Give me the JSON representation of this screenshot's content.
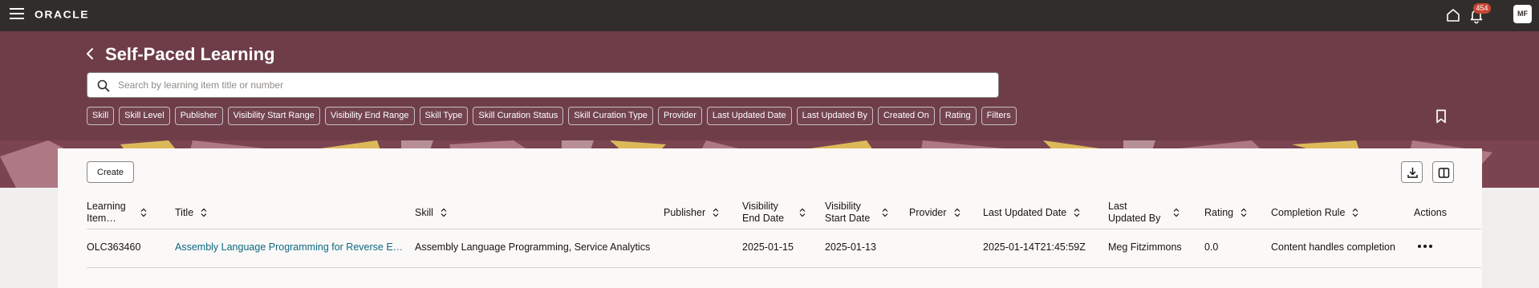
{
  "topbar": {
    "logo": "ORACLE",
    "notification_count": "454",
    "avatar_initials": "MF"
  },
  "header": {
    "title": "Self-Paced Learning",
    "search_placeholder": "Search by learning item title or number",
    "filters": [
      "Skill",
      "Skill Level",
      "Publisher",
      "Visibility Start Range",
      "Visibility End Range",
      "Skill Type",
      "Skill Curation Status",
      "Skill Curation Type",
      "Provider",
      "Last Updated Date",
      "Last Updated By",
      "Created On",
      "Rating",
      "Filters"
    ]
  },
  "toolbar": {
    "create_label": "Create"
  },
  "table": {
    "columns": [
      "Learning Item…",
      "Title",
      "Skill",
      "Publisher",
      "Visibility End Date",
      "Visibility Start Date",
      "Provider",
      "Last Updated Date",
      "Last Updated By",
      "Rating",
      "Completion Rule",
      "Actions"
    ],
    "rows": [
      {
        "number": "OLC363460",
        "title": "Assembly Language Programming for Reverse E…",
        "skill": "Assembly Language Programming, Service Analytics",
        "publisher": "",
        "visibility_end": "2025-01-15",
        "visibility_start": "2025-01-13",
        "provider": "",
        "last_updated_date": "2025-01-14T21:45:59Z",
        "last_updated_by": "Meg Fitzimmons",
        "rating": "0.0",
        "completion_rule": "Content handles completion"
      }
    ]
  }
}
